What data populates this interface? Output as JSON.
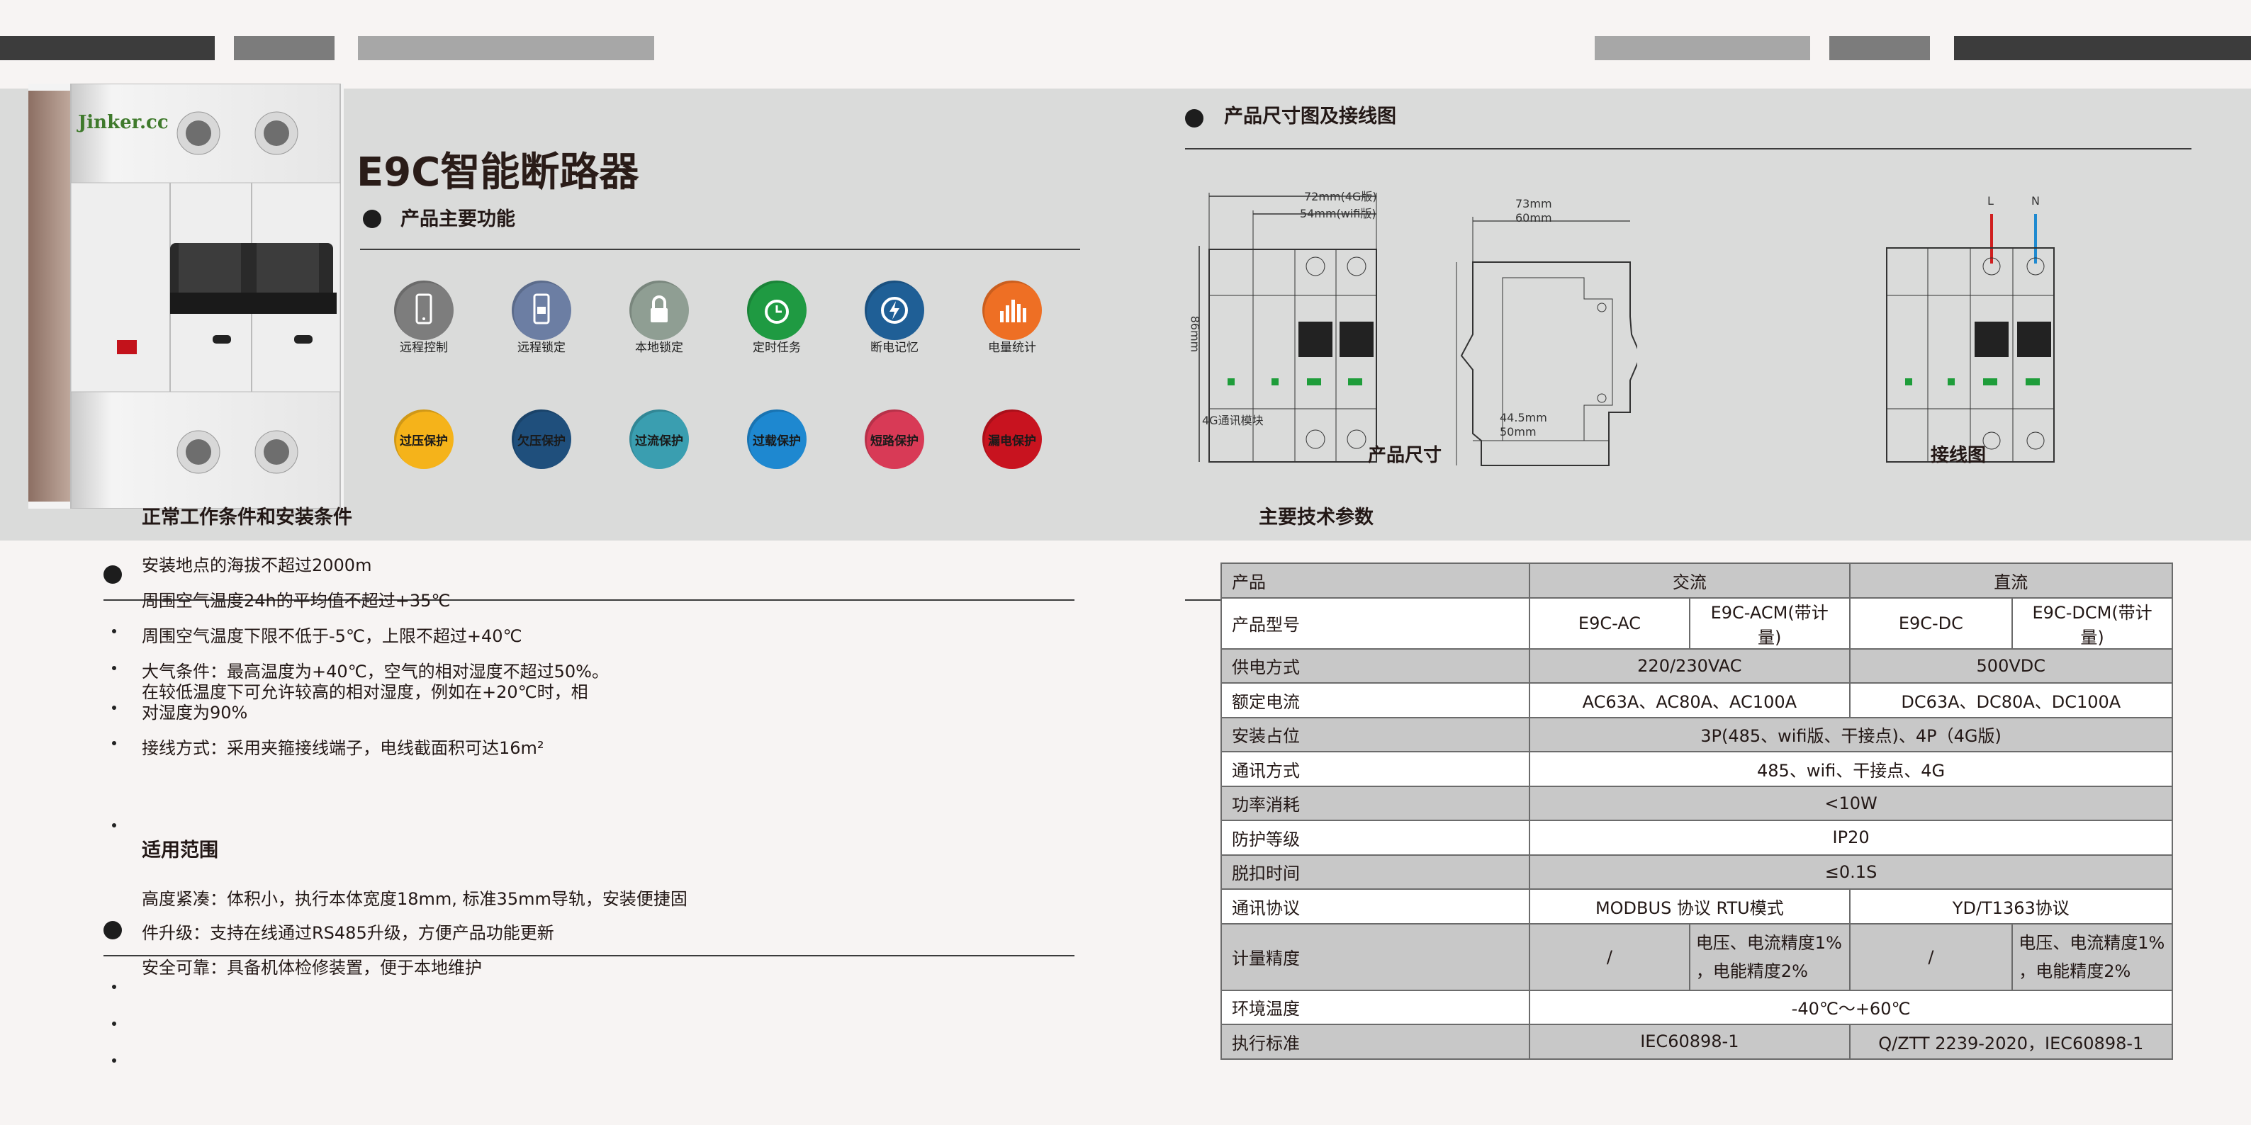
{
  "colors": {
    "banner": "#dadbda",
    "dark_bar": "#3c3c3c",
    "mid_bar": "#7c7c7c",
    "light_bar": "#a7a7a7"
  },
  "product_title": "E9C智能断路器",
  "brand_logo": "Jinker.cc",
  "sections": {
    "main_functions": "产品主要功能",
    "dimension_wiring": "产品尺寸图及接线图",
    "working_conditions": "正常工作条件和安装条件",
    "tech_params": "主要技术参数",
    "application": "适用范围"
  },
  "features": [
    {
      "label": "远程控制",
      "icon": "phone-icon",
      "color": "#7d7d7d"
    },
    {
      "label": "远程锁定",
      "icon": "phone-lock-icon",
      "color": "#6c7ea3"
    },
    {
      "label": "本地锁定",
      "icon": "padlock-icon",
      "color": "#8f9e93"
    },
    {
      "label": "定时任务",
      "icon": "alarm-clock-icon",
      "color": "#1f9a42"
    },
    {
      "label": "断电记忆",
      "icon": "power-memory-icon",
      "color": "#1f5f96"
    },
    {
      "label": "电量统计",
      "icon": "bar-chart-icon",
      "color": "#ee6f24"
    }
  ],
  "protections": [
    {
      "label": "过压保护",
      "icon": "overvoltage-icon",
      "color": "#f5b31a"
    },
    {
      "label": "欠压保护",
      "icon": "undervoltage-icon",
      "color": "#1f4f7c"
    },
    {
      "label": "过流保护",
      "icon": "overcurrent-icon",
      "color": "#3a9eb0"
    },
    {
      "label": "过载保护",
      "icon": "overload-icon",
      "color": "#1e88d0"
    },
    {
      "label": "短路保护",
      "icon": "short-circuit-icon",
      "color": "#d83a56"
    },
    {
      "label": "漏电保护",
      "icon": "leakage-icon",
      "color": "#c8131f"
    }
  ],
  "drawing": {
    "dim_width_4g": "72mm(4G版)",
    "dim_width_wifi": "54mm(wifi版)",
    "dim_height": "86mm",
    "module_label": "4G通讯模块",
    "dim_depth_1": "73mm",
    "dim_depth_2": "60mm",
    "dim_rail_1": "44.5mm",
    "dim_rail_2": "50mm",
    "size_caption": "产品尺寸",
    "wiring_caption": "接线图",
    "terminal_l": "L",
    "terminal_n": "N"
  },
  "conditions": [
    "安装地点的海拔不超过2000m",
    "周围空气温度24h的平均值不超过+35℃",
    "周围空气温度下限不低于-5℃，上限不超过+40℃",
    "大气条件：最高温度为+40℃，空气的相对湿度不超过50%。",
    "在较低温度下可允许较高的相对湿度，例如在+20℃时，相",
    "对湿度为90%",
    "接线方式：采用夹箍接线端子，电线截面积可达16m²"
  ],
  "applications": [
    "高度紧凑：体积小，执行本体宽度18mm, 标准35mm导轨，安装便捷固",
    "件升级：支持在线通过RS485升级，方便产品功能更新",
    "安全可靠：具备机体检修装置，便于本地维护"
  ],
  "spec_table": {
    "header": {
      "label": "产品",
      "ac": "交流",
      "dc": "直流"
    },
    "model": {
      "label": "产品型号",
      "m1": "E9C-AC",
      "m2": "E9C-ACM(带计量)",
      "m3": "E9C-DC",
      "m4": "E9C-DCM(带计量)"
    },
    "supply": {
      "label": "供电方式",
      "ac": "220/230VAC",
      "dc": "500VDC"
    },
    "current": {
      "label": "额定电流",
      "ac": "AC63A、AC80A、AC100A",
      "dc": "DC63A、DC80A、DC100A"
    },
    "install": {
      "label": "安装占位",
      "value": "3P(485、wifi版、干接点)、4P（4G版)"
    },
    "comm": {
      "label": "通讯方式",
      "value": "485、wifi、干接点、4G"
    },
    "power": {
      "label": "功率消耗",
      "value": "<10W"
    },
    "ip": {
      "label": "防护等级",
      "value": "IP20"
    },
    "trip": {
      "label": "脱扣时间",
      "value": "≤0.1S"
    },
    "protocol": {
      "label": "通讯协议",
      "ac": "MODBUS 协议 RTU模式",
      "dc": "YD/T1363协议"
    },
    "accuracy": {
      "label": "计量精度",
      "m1": "/",
      "m2a": "电压、电流精度1%",
      "m2b": "，电能精度2%",
      "m3": "/",
      "m4a": "电压、电流精度1%",
      "m4b": "，电能精度2%"
    },
    "temp": {
      "label": "环境温度",
      "value": "-40℃～+60℃"
    },
    "standard": {
      "label": "执行标准",
      "ac": "IEC60898-1",
      "dc": "Q/ZTT 2239-2020，IEC60898-1"
    }
  }
}
